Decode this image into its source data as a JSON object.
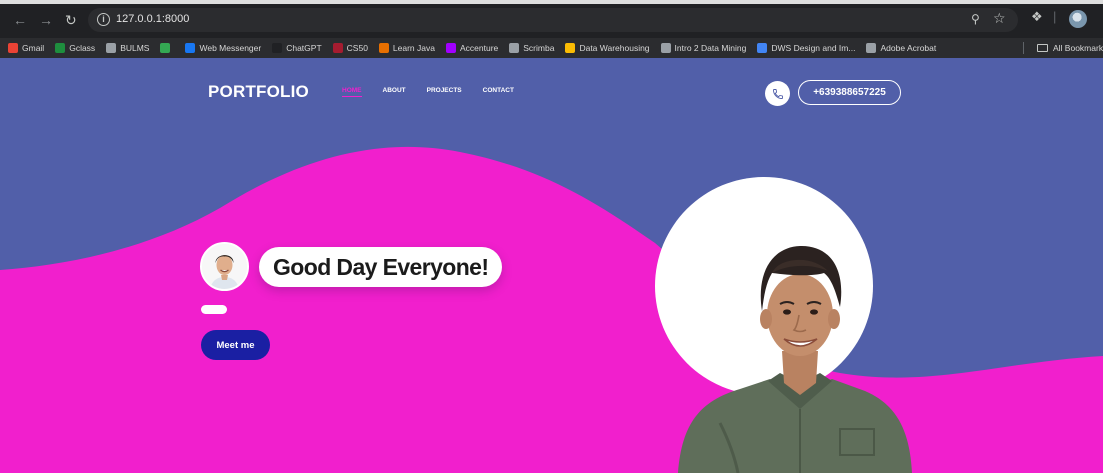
{
  "browser": {
    "url": "127.0.0.1:8000",
    "nav_icons": [
      "back-arrow-icon",
      "forward-arrow-icon",
      "reload-icon"
    ],
    "bookmarks": [
      {
        "label": "Gmail",
        "icon": "gmail-icon",
        "color": "#ea4335"
      },
      {
        "label": "Gclass",
        "icon": "google-classroom-icon",
        "color": "#1e8e3e"
      },
      {
        "label": "BULMS",
        "icon": "gear-logo-icon",
        "color": "#9aa0a6"
      },
      {
        "label": "",
        "icon": "green-circle-icon",
        "color": "#34a853"
      },
      {
        "label": "Web Messenger",
        "icon": "facebook-icon",
        "color": "#1877f2"
      },
      {
        "label": "ChatGPT",
        "icon": "chatgpt-icon",
        "color": "#202124"
      },
      {
        "label": "CS50",
        "icon": "cs50-icon",
        "color": "#a51c30"
      },
      {
        "label": "Learn Java",
        "icon": "java-icon",
        "color": "#e76f00"
      },
      {
        "label": "Accenture",
        "icon": "accenture-icon",
        "color": "#a100ff"
      },
      {
        "label": "Scrimba",
        "icon": "scrimba-icon",
        "color": "#9aa0a6"
      },
      {
        "label": "Data Warehousing",
        "icon": "google-drive-icon",
        "color": "#fbbc04"
      },
      {
        "label": "Intro 2 Data Mining",
        "icon": "globe-icon",
        "color": "#9aa0a6"
      },
      {
        "label": "DWS Design and Im...",
        "icon": "document-icon",
        "color": "#4285f4"
      },
      {
        "label": "Adobe Acrobat",
        "icon": "globe-icon",
        "color": "#9aa0a6"
      }
    ],
    "all_bookmarks_label": "All Bookmarks"
  },
  "site": {
    "logo": "PORTFOLIO",
    "nav": [
      {
        "label": "HOME",
        "active": true
      },
      {
        "label": "ABOUT",
        "active": false
      },
      {
        "label": "PROJECTS",
        "active": false
      },
      {
        "label": "CONTACT",
        "active": false
      }
    ],
    "phone": "+639388657225",
    "greeting": "Good Day Everyone!",
    "cta": "Meet me"
  },
  "colors": {
    "background": "#515fa9",
    "wave": "#f11fcd",
    "cta": "#1a1fa3",
    "active_nav": "#f11fcd"
  }
}
